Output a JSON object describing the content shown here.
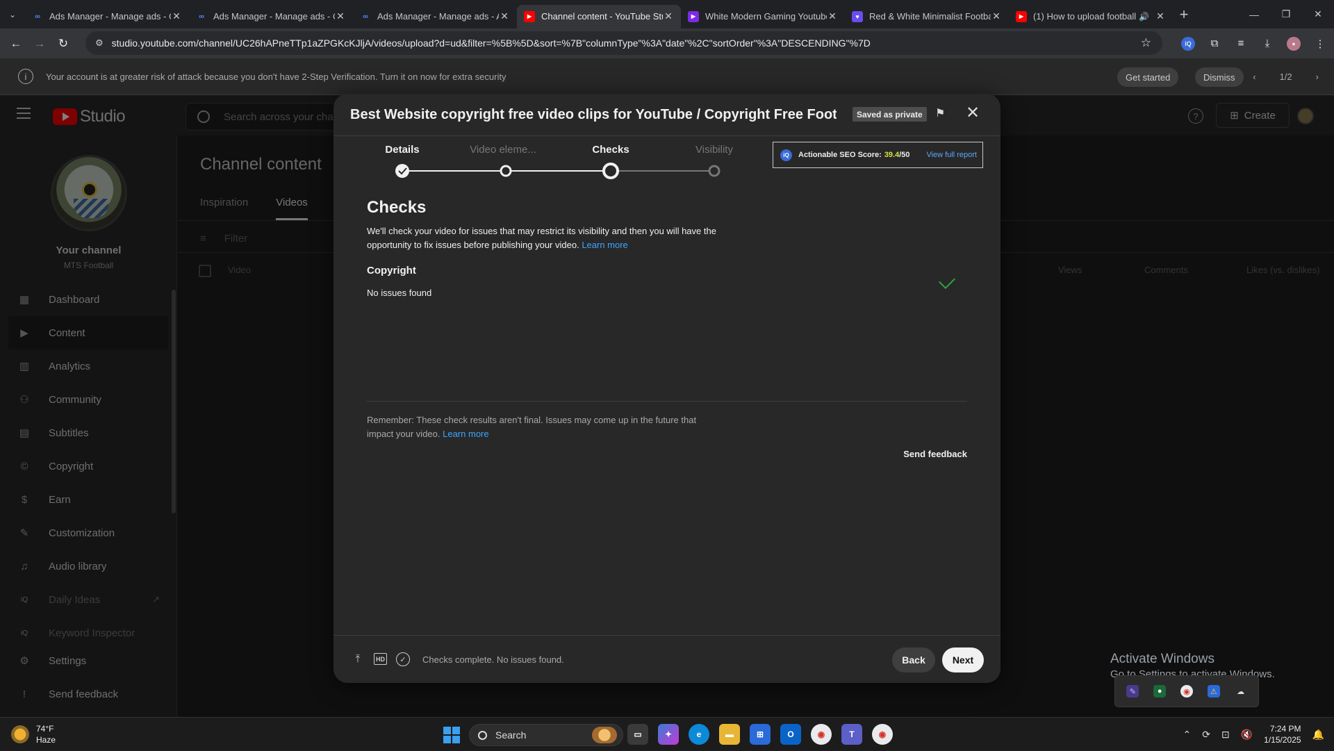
{
  "browser": {
    "tabs": [
      {
        "title": "Ads Manager - Manage ads - C",
        "favicon": "meta-icon",
        "active": false
      },
      {
        "title": "Ads Manager - Manage ads - C",
        "favicon": "meta-icon",
        "active": false
      },
      {
        "title": "Ads Manager - Manage ads - A",
        "favicon": "meta-icon",
        "active": false
      },
      {
        "title": "Channel content - YouTube Stu",
        "favicon": "youtube-icon",
        "active": true
      },
      {
        "title": "White Modern Gaming Youtube",
        "favicon": "canva-icon",
        "active": false
      },
      {
        "title": "Red & White Minimalist Footba",
        "favicon": "canva-heart-icon",
        "active": false
      },
      {
        "title": "(1) How to upload football",
        "favicon": "youtube-icon",
        "active": false
      }
    ],
    "url": "studio.youtube.com/channel/UC26hAPneTTp1aZPGKcKJljA/videos/upload?d=ud&filter=%5B%5D&sort=%7B\"columnType\"%3A\"date\"%2C\"sortOrder\"%3A\"DESCENDING\"%7D"
  },
  "banner": {
    "message": "Your account is at greater risk of attack because you don't have 2-Step Verification. Turn it on now for extra security",
    "get_started": "Get started",
    "dismiss": "Dismiss",
    "pager": "1/2"
  },
  "header": {
    "logo_text": "Studio",
    "search_placeholder": "Search across your cha",
    "create": "Create"
  },
  "sidebar": {
    "channel_title": "Your channel",
    "channel_name": "MTS Football",
    "items": [
      {
        "label": "Dashboard",
        "icon": "dashboard-icon"
      },
      {
        "label": "Content",
        "icon": "content-icon"
      },
      {
        "label": "Analytics",
        "icon": "analytics-icon"
      },
      {
        "label": "Community",
        "icon": "community-icon"
      },
      {
        "label": "Subtitles",
        "icon": "subtitles-icon"
      },
      {
        "label": "Copyright",
        "icon": "copyright-icon"
      },
      {
        "label": "Earn",
        "icon": "earn-icon"
      },
      {
        "label": "Customization",
        "icon": "customization-icon"
      },
      {
        "label": "Audio library",
        "icon": "audio-library-icon"
      },
      {
        "label": "Daily Ideas",
        "icon": "vidiq-icon"
      },
      {
        "label": "Keyword Inspector",
        "icon": "vidiq-icon"
      },
      {
        "label": "Settings",
        "icon": "gear-icon"
      },
      {
        "label": "Send feedback",
        "icon": "feedback-icon"
      }
    ]
  },
  "main": {
    "title": "Channel content",
    "tabs": [
      "Inspiration",
      "Videos"
    ],
    "filter_placeholder": "Filter",
    "columns": [
      "Video",
      "Views",
      "Comments",
      "Likes (vs. dislikes)"
    ]
  },
  "dialog": {
    "title": "Best Website copyright free video clips for YouTube / Copyright Free Foot...",
    "saved_badge": "Saved as private",
    "steps": [
      "Details",
      "Video eleme...",
      "Checks",
      "Visibility"
    ],
    "seo": {
      "label": "Actionable SEO Score:",
      "score": "39.4",
      "max": "/50",
      "link": "View full report"
    },
    "heading": "Checks",
    "description": "We'll check your video for issues that may restrict its visibility and then you will have the opportunity to fix issues before publishing your video.",
    "learn_more": "Learn more",
    "copyright_heading": "Copyright",
    "copyright_status": "No issues found",
    "remember": "Remember: These check results aren't final. Issues may come up in the future that impact your video.",
    "send_feedback": "Send feedback",
    "footer_status": "Checks complete. No issues found.",
    "back": "Back",
    "next": "Next",
    "hd_label": "HD"
  },
  "watermark": {
    "line1": "Activate Windows",
    "line2": "Go to Settings to activate Windows."
  },
  "taskbar": {
    "temp": "74°F",
    "condition": "Haze",
    "search": "Search",
    "time": "7:24 PM",
    "date": "1/15/2025"
  },
  "colors": {
    "accent_link": "#3ea6ff",
    "success": "#2ba640",
    "yt_red": "#ff0000"
  }
}
